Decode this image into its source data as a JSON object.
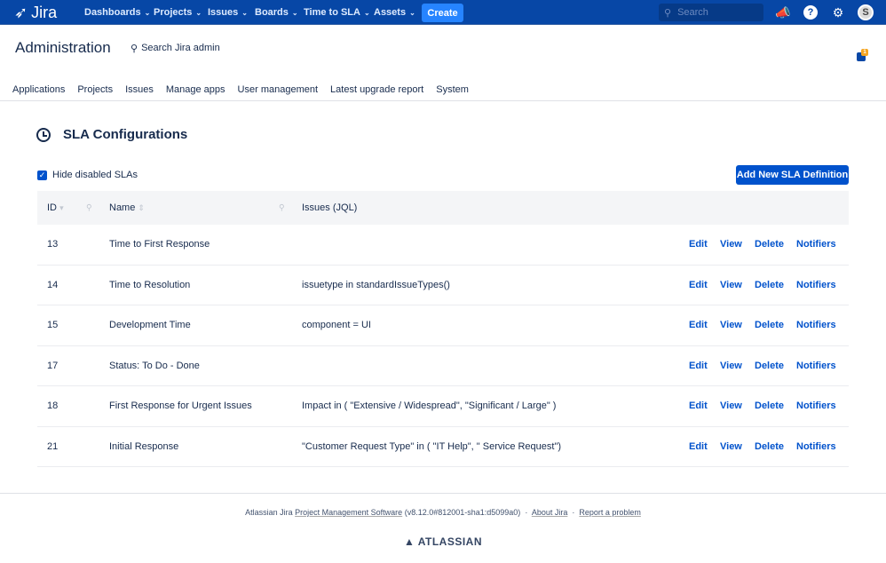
{
  "nav": {
    "logo": "Jira",
    "items": [
      "Dashboards",
      "Projects",
      "Issues",
      "Boards",
      "Time to SLA",
      "Assets"
    ],
    "create": "Create",
    "search_placeholder": "Search"
  },
  "admin": {
    "title": "Administration",
    "search": "Search Jira admin",
    "tabs": [
      "Applications",
      "Projects",
      "Issues",
      "Manage apps",
      "User management",
      "Latest upgrade report",
      "System"
    ],
    "feedback_count": "1"
  },
  "page": {
    "title": "SLA Configurations",
    "hide_disabled": "Hide disabled SLAs",
    "add_button": "Add New SLA Definition"
  },
  "table": {
    "headers": {
      "id": "ID",
      "name": "Name",
      "jql": "Issues (JQL)"
    },
    "actions": [
      "Edit",
      "View",
      "Delete",
      "Notifiers"
    ],
    "rows": [
      {
        "id": "13",
        "name": "Time to First Response",
        "jql": ""
      },
      {
        "id": "14",
        "name": "Time to Resolution",
        "jql": "issuetype in standardIssueTypes()"
      },
      {
        "id": "15",
        "name": "Development Time",
        "jql": "component = UI"
      },
      {
        "id": "17",
        "name": "Status: To Do - Done",
        "jql": ""
      },
      {
        "id": "18",
        "name": "First Response for Urgent Issues",
        "jql": "Impact in ( \"Extensive / Widespread\", \"Significant / Large\" )"
      },
      {
        "id": "21",
        "name": "Initial Response",
        "jql": "\"Customer Request Type\" in ( \"IT Help\", \" Service Request\")"
      }
    ]
  },
  "footer": {
    "prefix": "Atlassian Jira",
    "product": "Project Management Software",
    "version": "(v8.12.0#812001-sha1:d5099a0)",
    "about": "About Jira",
    "report": "Report a problem",
    "brand": "ATLASSIAN"
  }
}
